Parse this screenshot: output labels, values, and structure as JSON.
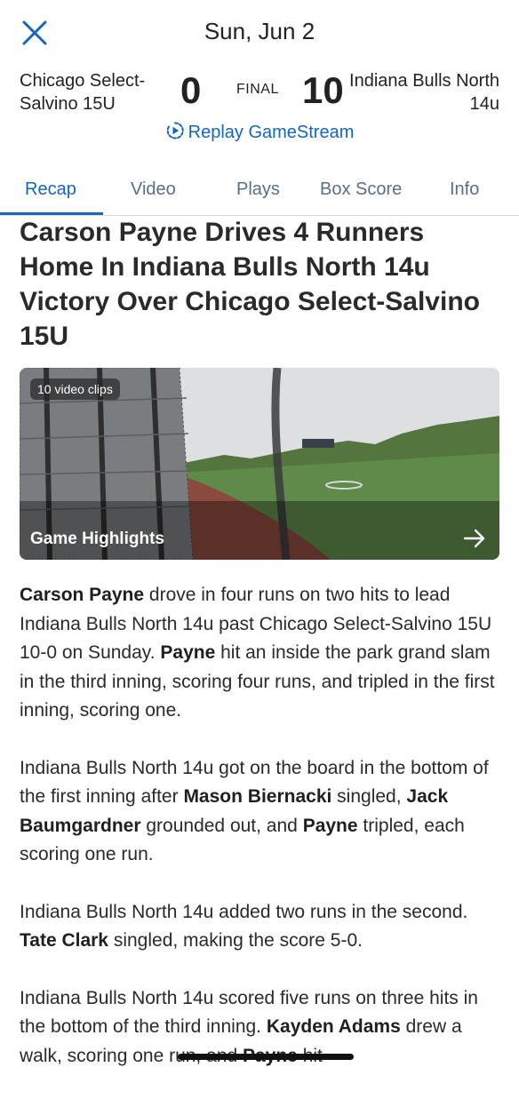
{
  "header": {
    "date": "Sun, Jun 2"
  },
  "game": {
    "away_team": "Chicago Select-Salvino 15U",
    "away_score": "0",
    "status": "FINAL",
    "home_score": "10",
    "home_team": "Indiana Bulls North 14u",
    "replay_label": "Replay GameStream"
  },
  "tabs": [
    {
      "label": "Recap"
    },
    {
      "label": "Video"
    },
    {
      "label": "Plays"
    },
    {
      "label": "Box Score"
    },
    {
      "label": "Info"
    }
  ],
  "recap": {
    "headline": "Carson Payne Drives 4 Runners Home In Indiana Bulls North 14u Victory Over Chicago Select-Salvino 15U",
    "video": {
      "clips_badge": "10 video clips",
      "title": "Game Highlights"
    },
    "paragraphs": [
      [
        {
          "t": "Carson Payne",
          "b": true
        },
        {
          "t": " drove in four runs on two hits to lead Indiana Bulls North 14u past Chicago Select-Salvino 15U 10-0 on Sunday. "
        },
        {
          "t": "Payne",
          "b": true
        },
        {
          "t": " hit an inside the park grand slam in the third inning, scoring four runs, and tripled in the first inning, scoring one."
        }
      ],
      [
        {
          "t": "Indiana Bulls North 14u got on the board in the bottom of the first inning after "
        },
        {
          "t": "Mason Biernacki",
          "b": true
        },
        {
          "t": " singled, "
        },
        {
          "t": "Jack Baumgardner",
          "b": true
        },
        {
          "t": " grounded out, and "
        },
        {
          "t": "Payne",
          "b": true
        },
        {
          "t": " tripled, each scoring one run."
        }
      ],
      [
        {
          "t": "Indiana Bulls North 14u added two runs in the second. "
        },
        {
          "t": "Tate Clark",
          "b": true
        },
        {
          "t": " singled, making the score 5-0."
        }
      ],
      [
        {
          "t": "Indiana Bulls North 14u scored five runs on three hits in the bottom of the third inning. "
        },
        {
          "t": "Kayden Adams",
          "b": true
        },
        {
          "t": " drew a walk, scoring one run, and "
        },
        {
          "t": "Payne",
          "b": true
        },
        {
          "t": " hit"
        }
      ]
    ]
  },
  "colors": {
    "accent": "#1565c0",
    "tab_inactive": "#5a6e86",
    "text": "#2a2a2a"
  },
  "icons": [
    "close-icon",
    "replay-play-icon",
    "arrow-right-icon"
  ]
}
